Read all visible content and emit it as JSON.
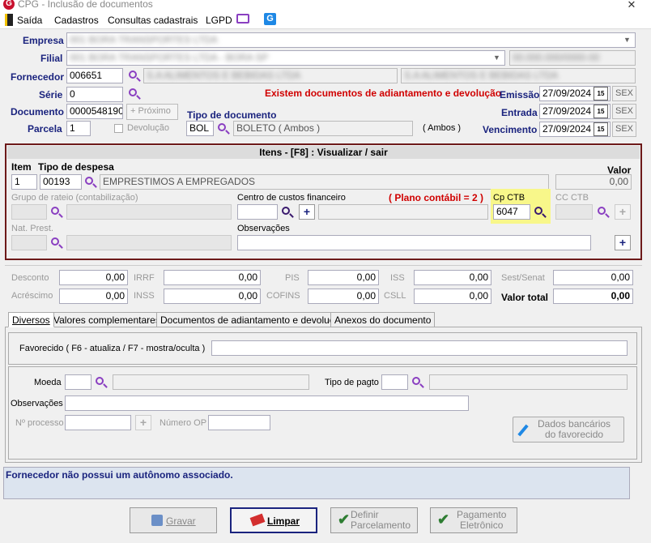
{
  "window": {
    "title": "CPG - Inclusão de documentos",
    "close": "✕"
  },
  "menu": {
    "exit": "Saída",
    "cadastros": "Cadastros",
    "consultas": "Consultas cadastrais",
    "lgpd": "LGPD"
  },
  "header": {
    "empresa_label": "Empresa",
    "filial_label": "Filial",
    "fornecedor_label": "Fornecedor",
    "serie_label": "Série",
    "documento_label": "Documento",
    "parcela_label": "Parcela",
    "empresa_value": "001 BORA TRANSPORTES LTDA",
    "filial_value": "001 BORA TRANSPORTES LTDA - BORA SP",
    "filial_cnpj": "00.000.000/0000-00",
    "fornecedor_code": "006651",
    "fornecedor_name": "S.A ALIMENTOS E BEBIDAS LTDA",
    "fornecedor_cnpj": "S.A ALIMENTOS E BEBIDAS LTDA",
    "serie_value": "0",
    "documento_value": "0000548190",
    "proximo": "Próximo",
    "devolucao": "Devolução",
    "parcela_value": "1",
    "warning": "Existem documentos de adiantamento e devolução",
    "tipo_doc_label": "Tipo de documento",
    "tipo_doc_code": "BOL",
    "tipo_doc_name": "BOLETO ( Ambos )",
    "tipo_doc_ambos": "( Ambos )",
    "emissao_label": "Emissão",
    "entrada_label": "Entrada",
    "vencimento_label": "Vencimento",
    "emissao": "27/09/2024",
    "entrada": "27/09/2024",
    "vencimento": "27/09/2024",
    "day": "SEX",
    "cal": "15"
  },
  "itens": {
    "title": "Itens  - [F8] : Visualizar / sair",
    "item_label": "Item",
    "tipo_despesa_label": "Tipo de despesa",
    "valor_label": "Valor",
    "item_value": "1",
    "despesa_code": "00193",
    "despesa_name": "EMPRESTIMOS A EMPREGADOS",
    "valor_value": "0,00",
    "grupo_rateio_label": "Grupo de rateio (contabilização)",
    "centro_custos_label": "Centro de custos financeiro",
    "plano_contabil": "( Plano contábil = 2 )",
    "cp_ctb_label": "Cp CTB",
    "cp_ctb_value": "6047",
    "cc_ctb_label": "CC CTB",
    "nat_prest_label": "Nat. Prest.",
    "observacoes_label": "Observações"
  },
  "totais": {
    "desconto": "Desconto",
    "acrescimo": "Acréscimo",
    "irrf": "IRRF",
    "inss": "INSS",
    "pis": "PIS",
    "cofins": "COFINS",
    "iss": "ISS",
    "csll": "CSLL",
    "sest": "Sest/Senat",
    "valor_total": "Valor total",
    "zero": "0,00"
  },
  "tabs": [
    "Diversos",
    "Valores complementares",
    "Documentos de adiantamento e devoluçao",
    "Anexos do documento"
  ],
  "diversos": {
    "favorecido_label": "Favorecido ( F6 - atualiza / F7 - mostra/oculta )",
    "moeda_label": "Moeda",
    "tipo_pagto_label": "Tipo de pagto",
    "observacoes_label": "Observações",
    "processo_label": "Nº processo",
    "numero_op_label": "Número OP",
    "dados_bancarios": "Dados bancários",
    "do_favorecido": "do favorecido"
  },
  "status": "Fornecedor não possui um autônomo associado.",
  "buttons": {
    "gravar": "Gravar",
    "limpar": "Limpar",
    "definir1": "Definir",
    "definir2": "Parcelamento",
    "pag1": "Pagamento",
    "pag2": "Eletrônico"
  }
}
